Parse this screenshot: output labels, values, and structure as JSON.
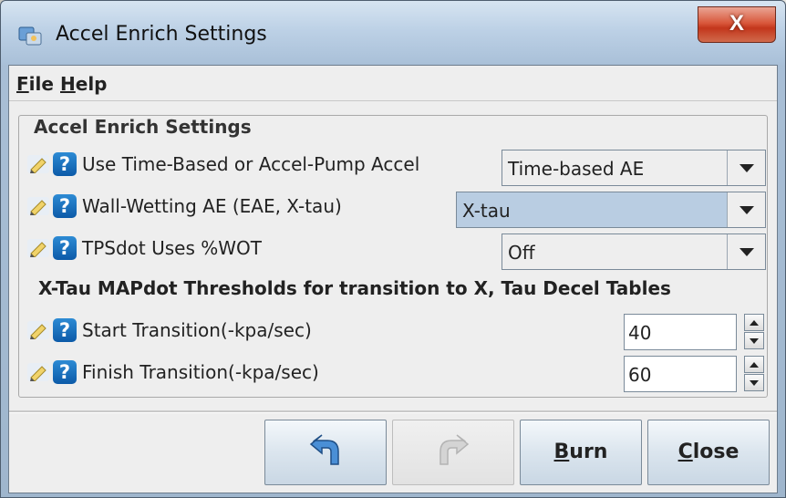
{
  "window": {
    "title": "Accel Enrich Settings",
    "close_glyph": "X"
  },
  "menu": [
    {
      "mnemonic": "F",
      "rest": "ile"
    },
    {
      "mnemonic": "H",
      "rest": "elp"
    }
  ],
  "group": {
    "title": "Accel Enrich Settings"
  },
  "rows": [
    {
      "label": "Use Time-Based or Accel-Pump Accel",
      "value": "Time-based AE"
    },
    {
      "label": "Wall-Wetting AE (EAE, X-tau)",
      "value": "X-tau"
    },
    {
      "label": "TPSdot Uses %WOT",
      "value": "Off"
    }
  ],
  "section": {
    "title": "X-Tau MAPdot Thresholds for transition to X, Tau Decel Tables"
  },
  "spinners": [
    {
      "label": "Start Transition(-kpa/sec)",
      "value": "40"
    },
    {
      "label": "Finish Transition(-kpa/sec)",
      "value": "60"
    }
  ],
  "help_glyph": "?",
  "buttons": {
    "undo_icon": "undo-icon",
    "redo_icon": "redo-icon",
    "burn": {
      "mnemonic": "B",
      "rest": "urn"
    },
    "close": {
      "mnemonic": "C",
      "rest": "lose"
    }
  }
}
